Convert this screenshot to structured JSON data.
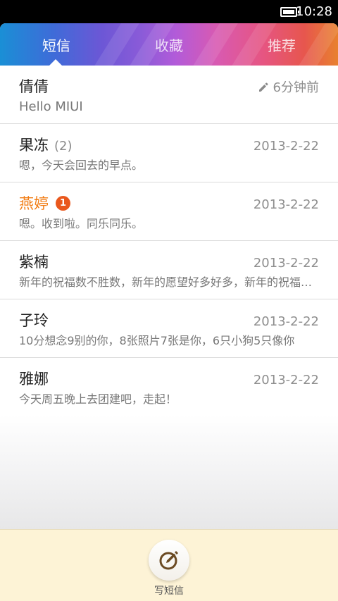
{
  "status_bar": {
    "time": "10:28"
  },
  "tabs": [
    {
      "label": "短信",
      "active": true
    },
    {
      "label": "收藏",
      "active": false
    },
    {
      "label": "推荐",
      "active": false
    }
  ],
  "messages": [
    {
      "name": "倩倩",
      "preview": "Hello MIUI",
      "time": "6分钟前",
      "draft": true
    },
    {
      "name": "果冻",
      "count": "(2)",
      "preview": "嗯，今天会回去的早点。",
      "time": "2013-2-22"
    },
    {
      "name": "燕婷",
      "badge": "1",
      "unread": true,
      "preview": "嗯。收到啦。同乐同乐。",
      "time": "2013-2-22"
    },
    {
      "name": "紫楠",
      "preview": "新年的祝福数不胜数，新年的愿望好多好多，新年的祝福送给你",
      "time": "2013-2-22"
    },
    {
      "name": "子玲",
      "preview": "10分想念9别的你，8张照片7张是你，6只小狗5只像你",
      "time": "2013-2-22"
    },
    {
      "name": "雅娜",
      "preview": "今天周五晚上去团建吧，走起！",
      "time": "2013-2-22"
    }
  ],
  "compose": {
    "label": "写短信"
  },
  "colors": {
    "unread_name": "#f27e16",
    "badge": "#e9571c",
    "bottom_bar": "#fdf3d6"
  },
  "icons": [
    "battery-icon",
    "pencil-icon",
    "compose-icon"
  ]
}
